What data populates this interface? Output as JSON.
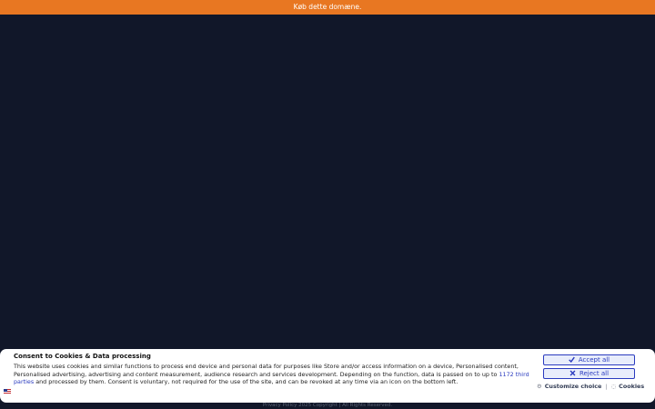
{
  "banner": {
    "text": "Køb dette domæne."
  },
  "consent": {
    "title": "Consent to Cookies & Data processing",
    "body_before_link": "This website uses cookies and similar functions to process end device and personal data for purposes like Store and/or access information on a device, Personalised content, Personalised advertising, advertising and content measurement, audience research and services development. Depending on the function, data is passed on to up to ",
    "link_text": "1172 third parties",
    "body_after_link": " and processed by them. Consent is voluntary, not required for the use of the site, and can be revoked at any time via an icon on the bottom left.",
    "accept_label": "Accept all",
    "reject_label": "Reject all",
    "customize_label": "Customize choice",
    "separator": "|",
    "cookies_label": "Cookies",
    "language_icon": "us-flag-icon"
  },
  "footer": {
    "privacy_label": "Privacy Policy",
    "copyright": "2025 Copyright | All Rights Reserved."
  },
  "colors": {
    "banner_bg": "#e87722",
    "page_bg": "#111729",
    "button_accent": "#2a3bbf"
  }
}
